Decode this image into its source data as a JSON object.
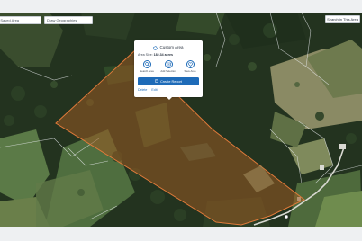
{
  "toolbar": {
    "saved_area_label": "a Saved Area",
    "geography_placeholder": "Draw Geographies",
    "search_area_label": "Search in This Area"
  },
  "popup": {
    "title": "Custom Area",
    "area_label": "Area Size:",
    "area_value": "182.34 acres",
    "actions": [
      {
        "label": "Search Area",
        "icon": "search-icon"
      },
      {
        "label": "Add Selection",
        "icon": "add-selection-icon"
      },
      {
        "label": "Save Area",
        "icon": "heart-icon"
      }
    ],
    "report_button": "Create Report",
    "links": [
      "Delete",
      "Edit"
    ]
  },
  "colors": {
    "accent": "#1e6bb8",
    "parcel_fill": "#9b5a22",
    "parcel_stroke": "#e07a3a"
  }
}
